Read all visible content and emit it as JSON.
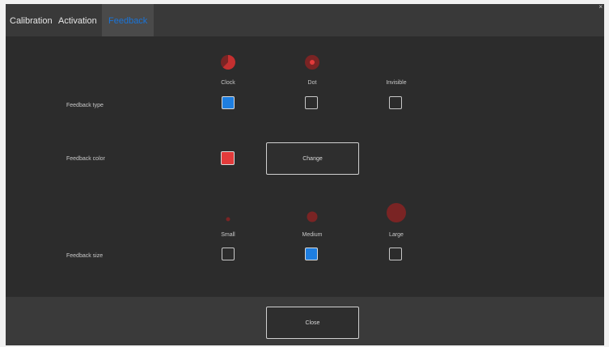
{
  "tabs": [
    {
      "label": "Calibration"
    },
    {
      "label": "Activation"
    },
    {
      "label": "Feedback"
    }
  ],
  "active_tab": "Feedback",
  "window_close_glyph": "×",
  "feedback_type": {
    "label": "Feedback type",
    "options": [
      {
        "label": "Clock",
        "icon": "clock-icon",
        "checked": true
      },
      {
        "label": "Dot",
        "icon": "dot-icon",
        "checked": false
      },
      {
        "label": "Invisible",
        "icon": "none",
        "checked": false
      }
    ]
  },
  "feedback_color": {
    "label": "Feedback color",
    "swatch_color": "#e33b3b",
    "change_label": "Change"
  },
  "feedback_size": {
    "label": "Feedback size",
    "options": [
      {
        "label": "Small",
        "checked": false
      },
      {
        "label": "Medium",
        "checked": true
      },
      {
        "label": "Large",
        "checked": false
      }
    ]
  },
  "footer": {
    "close_label": "Close"
  },
  "colors": {
    "accent": "#1e7ee0",
    "feedback_red": "#e33b3b",
    "dim_red": "#7a2424",
    "background": "#2c2c2c"
  }
}
